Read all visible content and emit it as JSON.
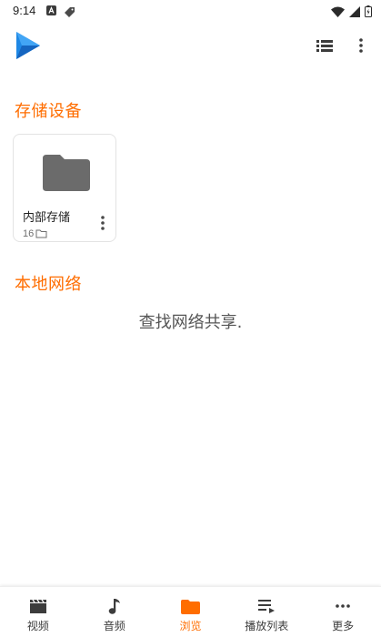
{
  "status_bar": {
    "time": "9:14",
    "icons": [
      "a-notification-icon",
      "tag-icon",
      "wifi-icon",
      "cellular-signal-icon",
      "battery-icon"
    ]
  },
  "app_bar": {
    "logo": "play-logo-icon",
    "actions": [
      "list-view-icon",
      "more-vert-icon"
    ]
  },
  "sections": {
    "storage": {
      "header": "存储设备",
      "items": [
        {
          "title": "内部存储",
          "count": "16",
          "icon": "folder-icon"
        }
      ]
    },
    "network": {
      "header": "本地网络",
      "empty_text": "查找网络共享."
    }
  },
  "bottom_nav": {
    "items": [
      {
        "label": "视频",
        "icon": "video-clapper-icon",
        "active": false
      },
      {
        "label": "音频",
        "icon": "music-note-icon",
        "active": false
      },
      {
        "label": "浏览",
        "icon": "folder-icon",
        "active": true
      },
      {
        "label": "播放列表",
        "icon": "playlist-icon",
        "active": false
      },
      {
        "label": "更多",
        "icon": "more-horiz-icon",
        "active": false
      }
    ]
  },
  "colors": {
    "accent": "#ff6d00",
    "logo": "#1e88e5",
    "folder": "#6b6b6b"
  }
}
